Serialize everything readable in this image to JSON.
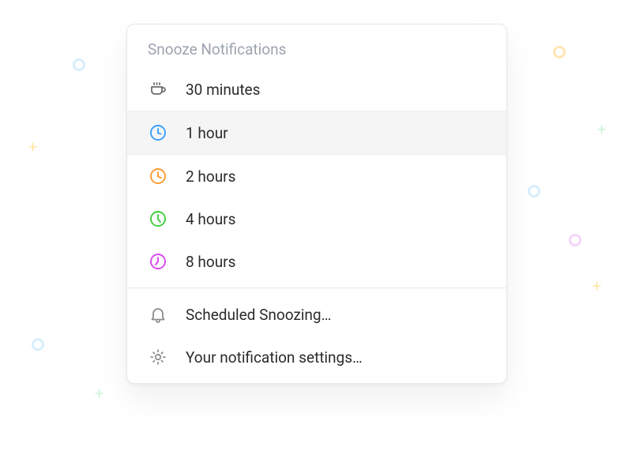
{
  "menu": {
    "title": "Snooze Notifications",
    "options": [
      {
        "label": "30 minutes"
      },
      {
        "label": "1 hour"
      },
      {
        "label": "2 hours"
      },
      {
        "label": "4 hours"
      },
      {
        "label": "8 hours"
      }
    ],
    "footer": [
      {
        "label": "Scheduled Snoozing…"
      },
      {
        "label": "Your notification settings…"
      }
    ]
  },
  "colors": {
    "coffee": "#6b6b6b",
    "clock_blue": "#39a0ff",
    "clock_orange": "#ff9a2e",
    "clock_green": "#3ecf3e",
    "clock_magenta": "#d946ef",
    "bell": "#8d8d8d",
    "gear": "#8d8d8d"
  }
}
